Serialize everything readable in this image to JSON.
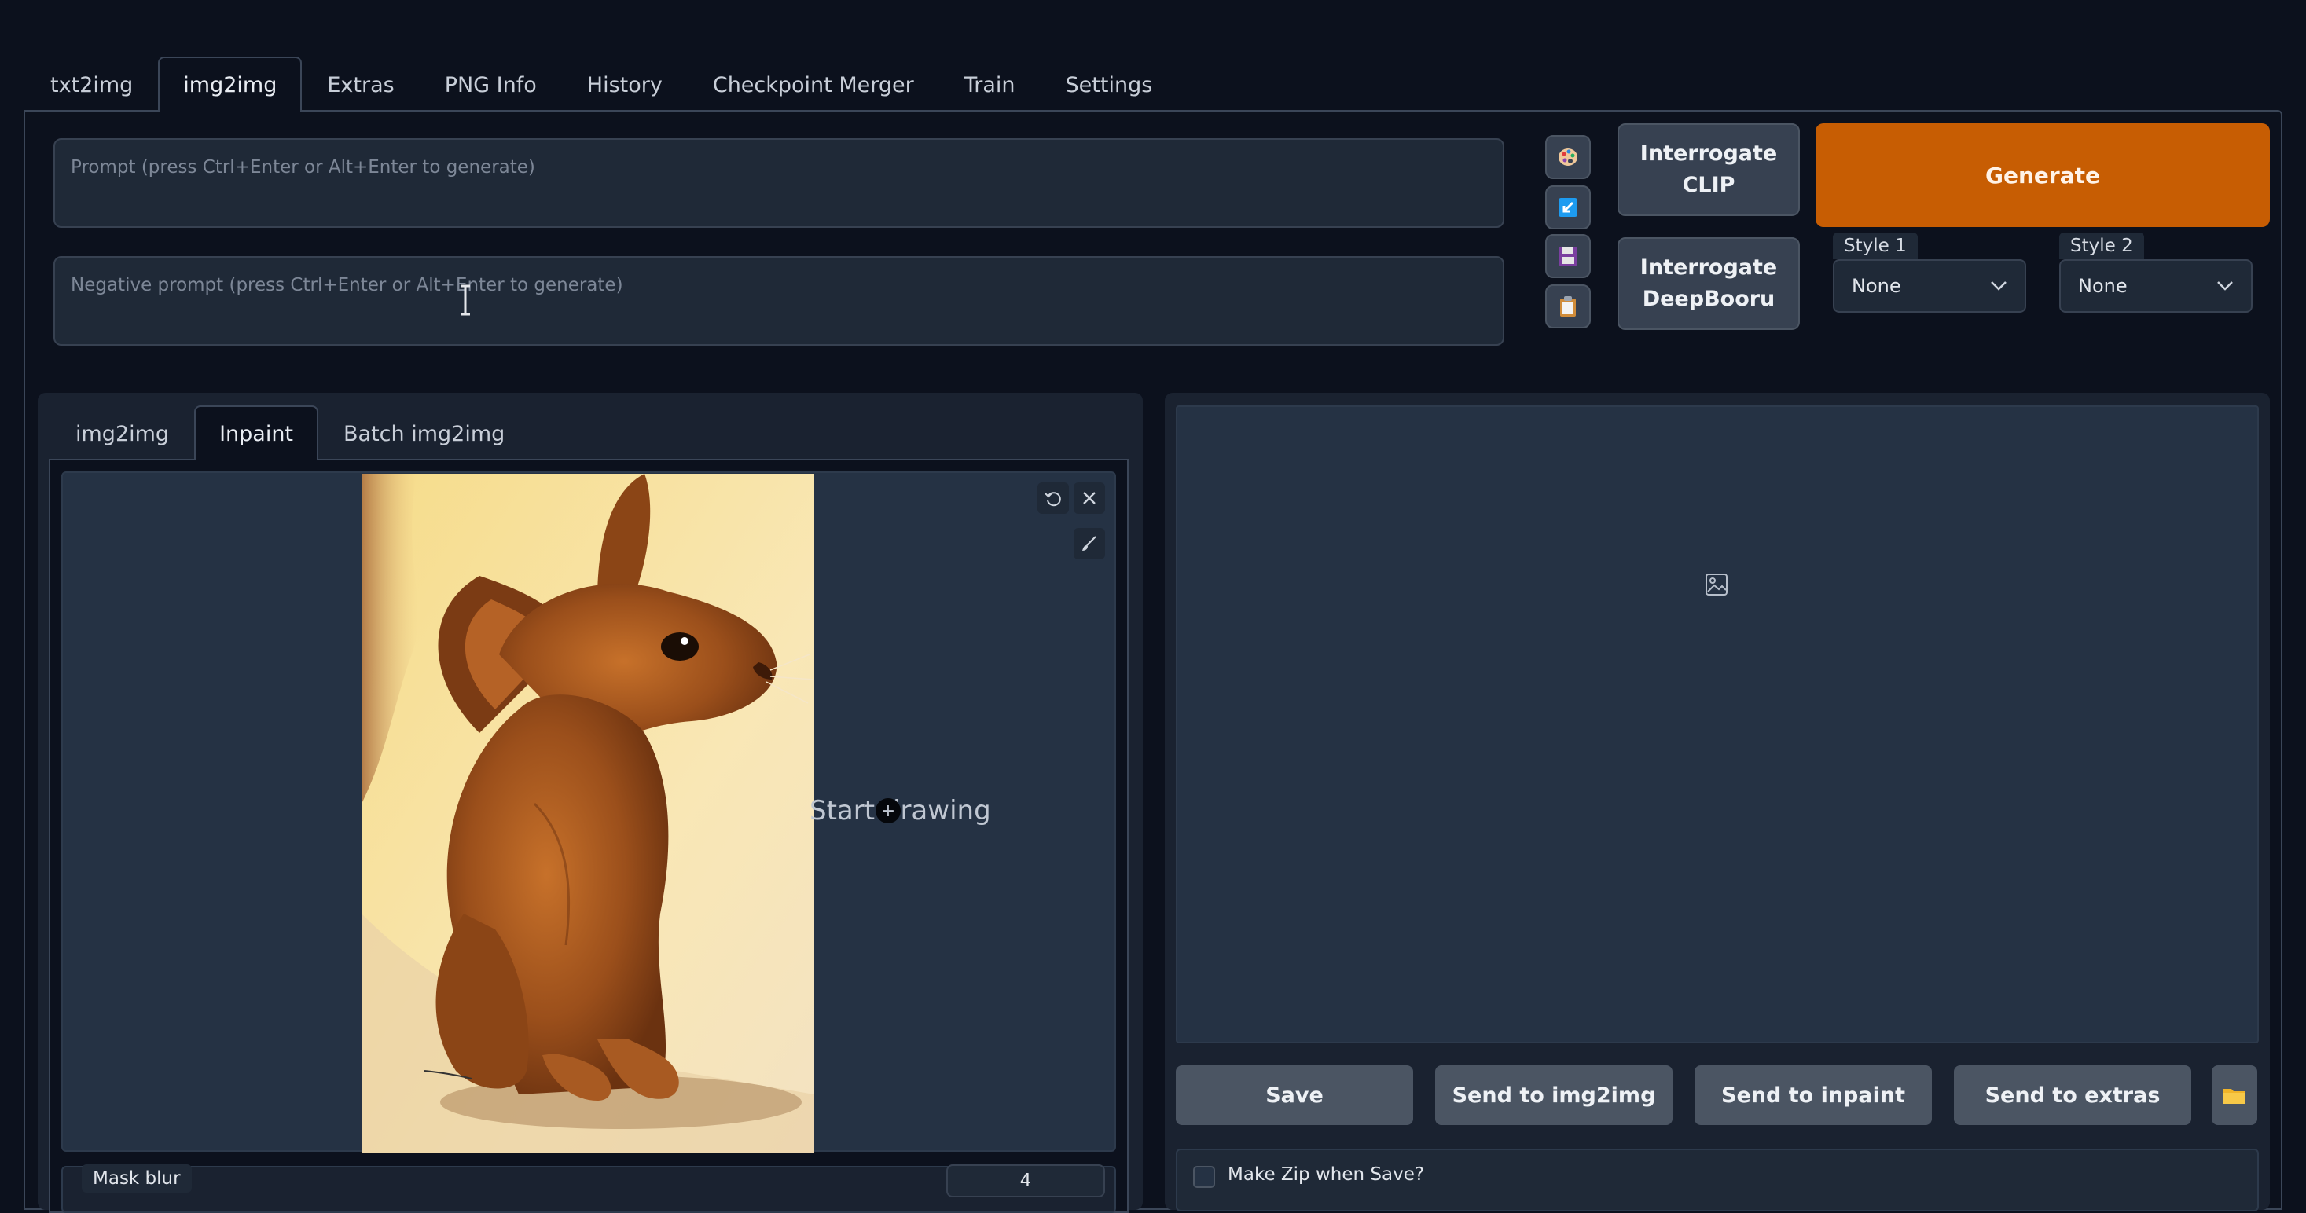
{
  "top_tabs": [
    {
      "label": "txt2img",
      "active": false
    },
    {
      "label": "img2img",
      "active": true
    },
    {
      "label": "Extras",
      "active": false
    },
    {
      "label": "PNG Info",
      "active": false
    },
    {
      "label": "History",
      "active": false
    },
    {
      "label": "Checkpoint Merger",
      "active": false
    },
    {
      "label": "Train",
      "active": false
    },
    {
      "label": "Settings",
      "active": false
    }
  ],
  "prompt": {
    "placeholder": "Prompt (press Ctrl+Enter or Alt+Enter to generate)",
    "value": ""
  },
  "negative_prompt": {
    "placeholder": "Negative prompt (press Ctrl+Enter or Alt+Enter to generate)",
    "value": ""
  },
  "tool_buttons": [
    "palette-icon",
    "arrow-checkbox-icon",
    "save-disk-icon",
    "clipboard-icon"
  ],
  "interrogate_clip": {
    "line1": "Interrogate",
    "line2": "CLIP"
  },
  "interrogate_deepbooru": {
    "line1": "Interrogate",
    "line2": "DeepBooru"
  },
  "generate_label": "Generate",
  "style1": {
    "label": "Style 1",
    "value": "None"
  },
  "style2": {
    "label": "Style 2",
    "value": "None"
  },
  "sub_tabs": [
    {
      "label": "img2img",
      "active": false
    },
    {
      "label": "Inpaint",
      "active": true
    },
    {
      "label": "Batch img2img",
      "active": false
    }
  ],
  "canvas": {
    "hint": "Start drawing"
  },
  "mask_blur": {
    "label": "Mask blur",
    "value": "4"
  },
  "output_buttons": {
    "save": "Save",
    "send_img2img": "Send to img2img",
    "send_inpaint": "Send to inpaint",
    "send_extras": "Send to extras"
  },
  "make_zip": {
    "label": "Make Zip when Save?",
    "checked": false
  },
  "colors": {
    "accent": "#c75d03",
    "background": "#0c111d",
    "panel": "#1a2230"
  }
}
